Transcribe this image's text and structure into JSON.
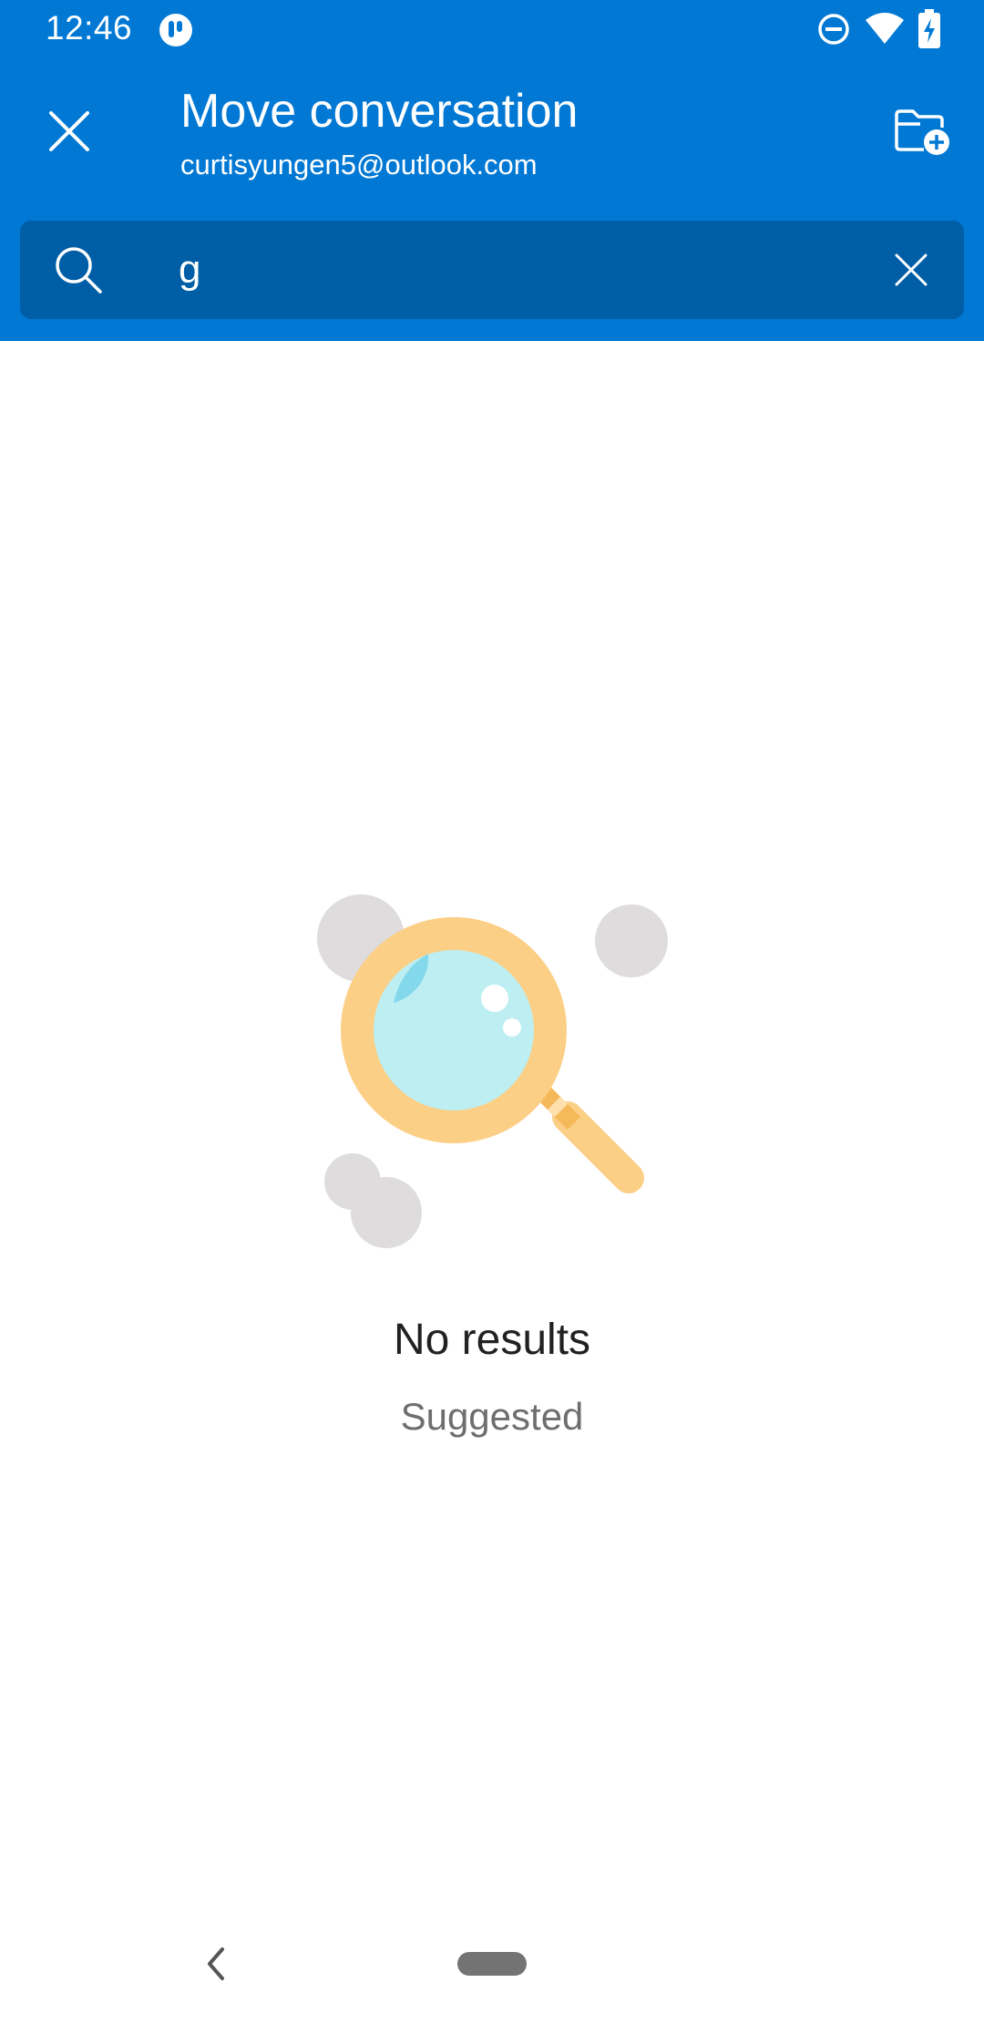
{
  "status_bar": {
    "time": "12:46"
  },
  "header": {
    "title": "Move conversation",
    "account": "curtisyungen5@outlook.com",
    "close_icon": "close-icon",
    "new_folder_icon": "folder-add-icon"
  },
  "search": {
    "value": "g",
    "search_icon": "search-icon",
    "clear_icon": "clear-icon"
  },
  "empty_state": {
    "title": "No results",
    "subtitle": "Suggested",
    "illustration_icon": "magnifying-glass-icon"
  },
  "colors": {
    "header_bg": "#0078d4",
    "search_bg": "#005ea6",
    "title_text": "#212121",
    "subtitle_text": "#6e6e6e"
  }
}
